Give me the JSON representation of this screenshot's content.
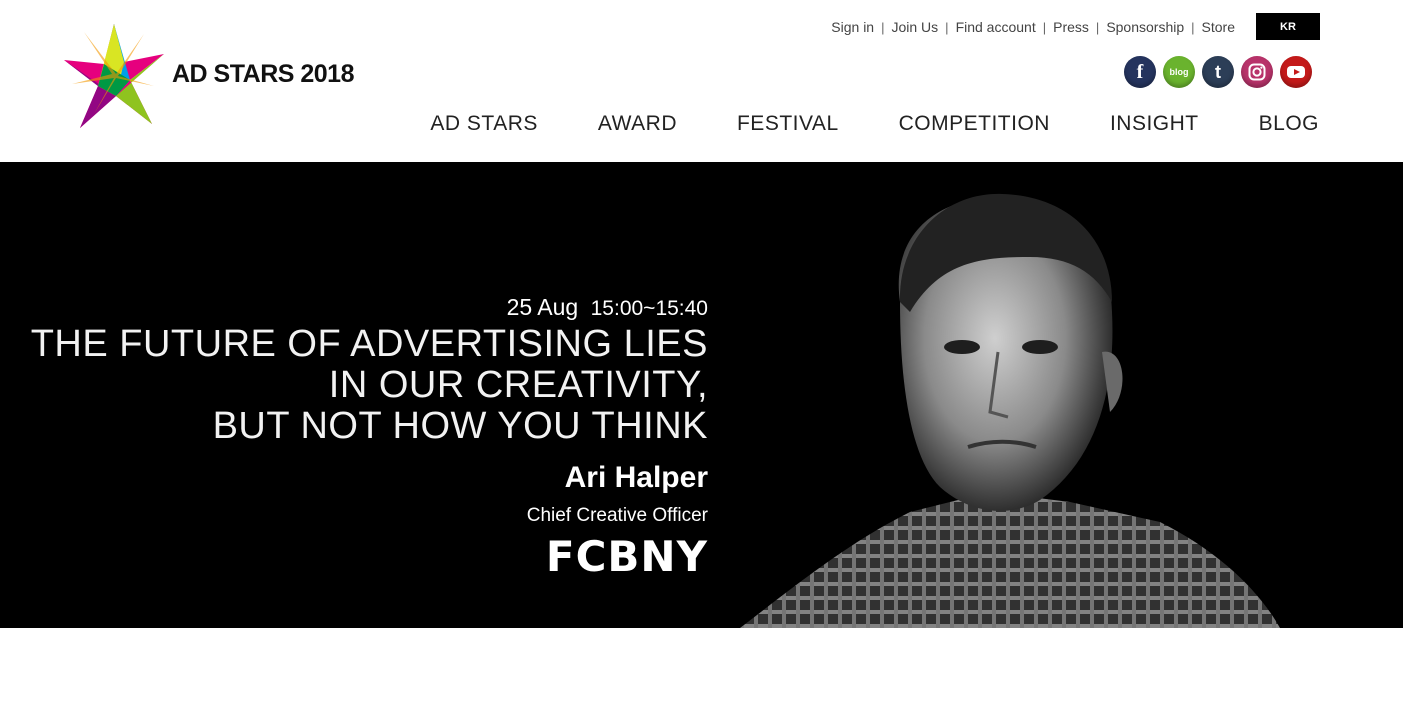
{
  "brand": {
    "name": "AD STARS 2018"
  },
  "util_nav": {
    "items": [
      "Sign in",
      "Join Us",
      "Find account",
      "Press",
      "Sponsorship",
      "Store"
    ],
    "language": "KR"
  },
  "social": {
    "facebook": "f",
    "blog": "blog",
    "tumblr": "t",
    "instagram": "instagram-icon",
    "youtube": "youtube-icon"
  },
  "main_nav": {
    "items": [
      "AD STARS",
      "AWARD",
      "FESTIVAL",
      "COMPETITION",
      "INSIGHT",
      "BLOG"
    ]
  },
  "hero": {
    "date": "25 Aug",
    "time": "15:00~15:40",
    "title_lines": [
      "THE FUTURE OF ADVERTISING LIES",
      "IN OUR CREATIVITY,",
      "BUT NOT HOW YOU THINK"
    ],
    "speaker_name": "Ari Halper",
    "speaker_role": "Chief Creative Officer",
    "company": "FCBNY"
  },
  "colors": {
    "hero_bg": "#000000",
    "lang_btn_bg": "#000000",
    "facebook": "#25345e",
    "blog": "#6ab32e",
    "tumblr": "#2c3e57",
    "instagram": "#b8336a",
    "youtube": "#c41a1a"
  }
}
